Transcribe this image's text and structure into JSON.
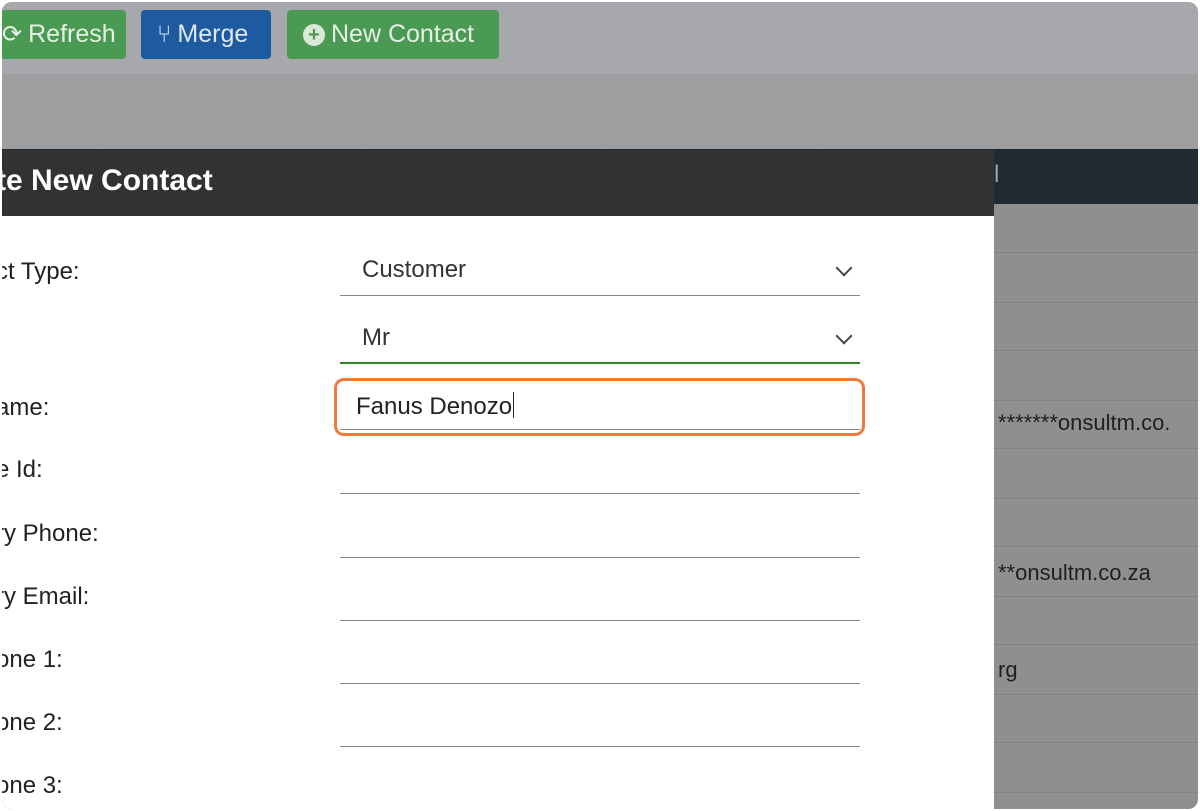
{
  "toolbar": {
    "refresh_label": "Refresh",
    "merge_label": "Merge",
    "new_contact_label": "New Contact"
  },
  "table": {
    "column_fragment": "l",
    "visible_cells": [
      "*******onsultm.co.",
      "**onsultm.co.za",
      "rg"
    ]
  },
  "modal": {
    "title": "te New Contact",
    "fields": {
      "contact_type": {
        "label": "ct Type:",
        "value": "Customer"
      },
      "title": {
        "value": "Mr"
      },
      "name": {
        "label": "ame:",
        "value": "Fanus Denozo"
      },
      "id": {
        "label": "e Id:",
        "value": ""
      },
      "primary_phone": {
        "label": "ry Phone:",
        "value": ""
      },
      "primary_email": {
        "label": "ry Email:",
        "value": ""
      },
      "phone1": {
        "label": "one 1:",
        "value": ""
      },
      "phone2": {
        "label": "one 2:",
        "value": ""
      },
      "phone3": {
        "label": "one 3:",
        "value": ""
      }
    }
  },
  "colors": {
    "highlight": "#f07a3e",
    "focus_underline": "#2e8b1f",
    "button_green": "#4b9a54",
    "button_blue": "#1d5aa0"
  }
}
